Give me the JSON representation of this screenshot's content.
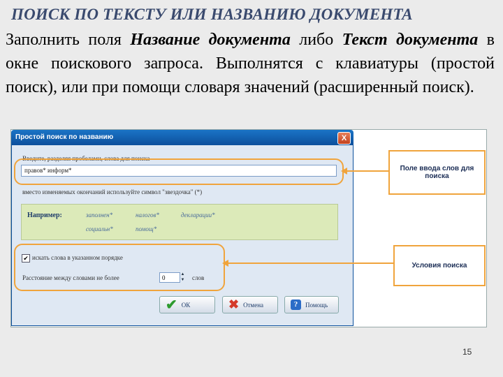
{
  "slide": {
    "title": "ПОИСК ПО ТЕКСТУ ИЛИ НАЗВАНИЮ ДОКУМЕНТА",
    "text_1": "Заполнить поля ",
    "text_2": "Название документа",
    "text_3": " либо ",
    "text_4": "Текст документа",
    "text_5": " в окне поискового запроса. Выполнятся с клавиатуры (простой поиск), или при помощи словаря значений (расширенный поиск).",
    "page_number": "15"
  },
  "dialog": {
    "title": "Простой поиск по названию",
    "close_label": "X",
    "prompt": "Введите, разделяя пробелами, слова для поиска",
    "search_value": "правов* информ*",
    "hint": "вместо изменяемых окончаний используйте символ \"звездочка\" (*)",
    "example": {
      "label": "Например:",
      "words": [
        "заполнен*",
        "налогов*",
        "декларации*",
        "социальн*",
        "помощ*"
      ]
    },
    "checkbox_label": "искать слова в указанном порядке",
    "checkbox_checked": true,
    "distance_label": "Расстояние между словами не более",
    "distance_value": "0",
    "distance_unit": "слов",
    "buttons": {
      "ok": "ОК",
      "cancel": "Отмена",
      "help": "Помощь"
    }
  },
  "callouts": {
    "input": "Поле ввода слов для поиска",
    "conditions": "Условия поиска"
  },
  "colors": {
    "accent": "#f0a43c",
    "titlebar": "#0c4f9c",
    "example_bg": "#dceab9"
  }
}
